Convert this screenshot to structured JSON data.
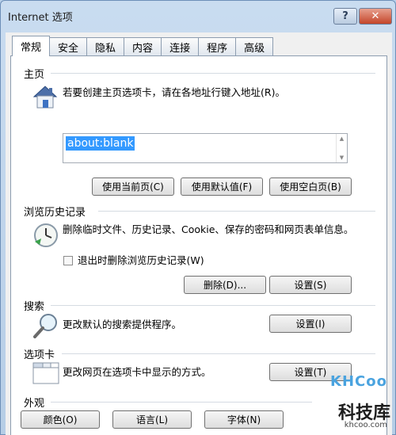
{
  "window": {
    "title": "Internet 选项",
    "help": "?",
    "close": "✕"
  },
  "tabs": [
    "常规",
    "安全",
    "隐私",
    "内容",
    "连接",
    "程序",
    "高级"
  ],
  "home": {
    "title": "主页",
    "description": "若要创建主页选项卡，请在各地址行键入地址(R)。",
    "url_value": "about:blank",
    "buttons": {
      "use_current": "使用当前页(C)",
      "use_default": "使用默认值(F)",
      "use_blank": "使用空白页(B)"
    }
  },
  "history": {
    "title": "浏览历史记录",
    "description": "删除临时文件、历史记录、Cookie、保存的密码和网页表单信息。",
    "checkbox_label": "退出时删除浏览历史记录(W)",
    "checkbox_checked": false,
    "buttons": {
      "delete": "删除(D)...",
      "settings": "设置(S)"
    }
  },
  "search": {
    "title": "搜索",
    "description": "更改默认的搜索提供程序。",
    "buttons": {
      "settings": "设置(I)"
    }
  },
  "tabs_section": {
    "title": "选项卡",
    "description": "更改网页在选项卡中显示的方式。",
    "buttons": {
      "settings": "设置(T)"
    }
  },
  "appearance": {
    "title": "外观",
    "buttons": {
      "colors": "颜色(O)",
      "languages": "语言(L)",
      "fonts": "字体(N)"
    }
  },
  "watermark": {
    "logo": "KHCoo",
    "name": "科技库",
    "url": "khcoo.com"
  },
  "colors": {
    "selection": "#3399ff",
    "close_button": "#c3452a",
    "frame": "#b9d1ea"
  }
}
